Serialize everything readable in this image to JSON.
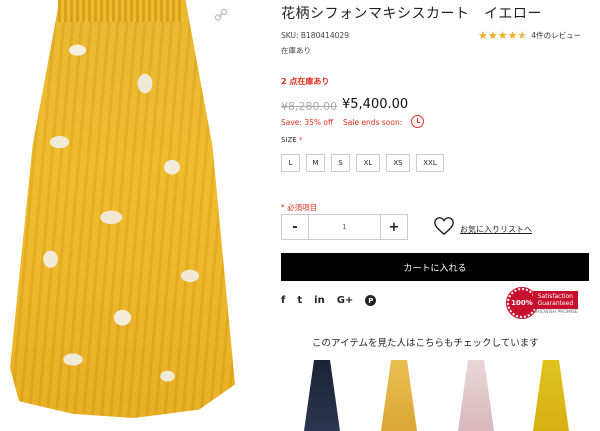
{
  "product": {
    "title": "花柄シフォンマキシスカート　イエロー",
    "sku": "SKU: B180414029",
    "stock_status": "在庫あり",
    "reviews": "4件のレビュー",
    "rating": 4.5,
    "stock_left": "2 点在庫あり",
    "old_price": "¥8,280.00",
    "price": "¥5,400.00",
    "save": "Save: 35% off",
    "sale_ends": "Sale ends soon:",
    "size_label": "SIZE",
    "size_required": "*",
    "sizes": [
      "L",
      "M",
      "S",
      "XL",
      "XS",
      "XXL"
    ],
    "required_note": "* 必須項目",
    "quantity": "1",
    "qty_minus": "-",
    "qty_plus": "+",
    "wishlist": "お気に入りリストへ",
    "add_to_cart": "カートに入れる"
  },
  "social": [
    "f",
    "t",
    "in",
    "G+",
    "P"
  ],
  "badge": {
    "seal": "100%",
    "line1": "Satisfaction",
    "line2": "Guaranteed",
    "sub": "CHICWISH PROMISE"
  },
  "recommendations": {
    "title": "このアイテムを見た人はこちらもチェックしています"
  },
  "colors": {
    "accent_red": "#e0301e",
    "star": "#f0ad1e",
    "button": "#000000",
    "product_yellow": "#f0b928"
  },
  "icons": {
    "photo_link": "link-icon",
    "clock": "clock-icon",
    "wishlist": "heart-icon",
    "facebook": "facebook-icon",
    "twitter": "twitter-icon",
    "linkedin": "linkedin-icon",
    "google_plus": "google-plus-icon",
    "pinterest": "pinterest-icon"
  }
}
